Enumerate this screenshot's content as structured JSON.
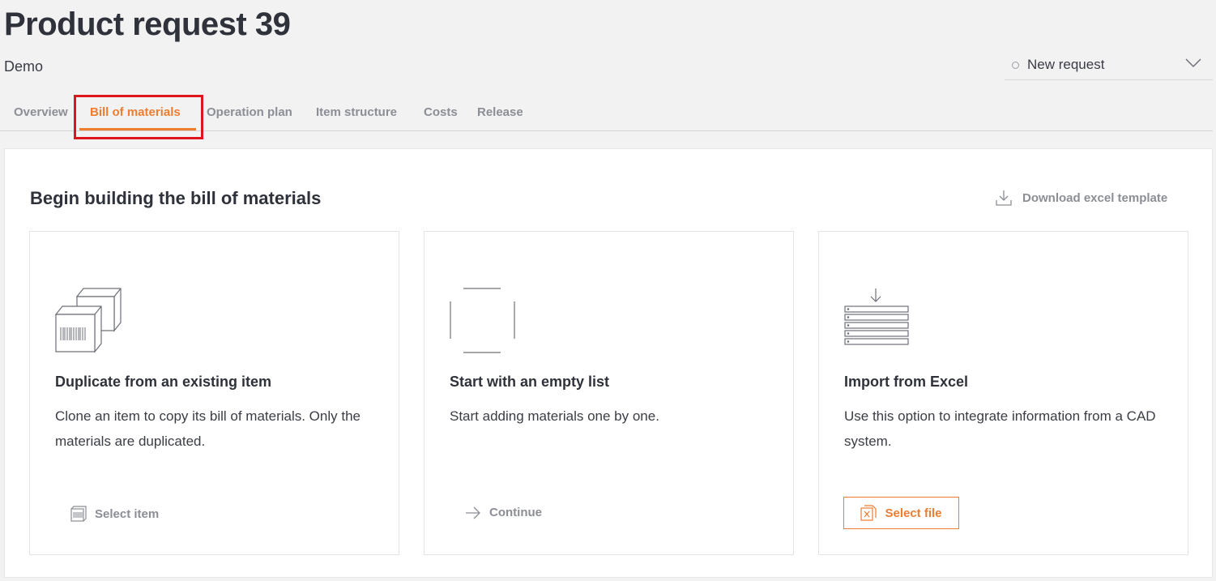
{
  "header": {
    "title": "Product request 39",
    "subtitle": "Demo",
    "status": "New request"
  },
  "tabs": [
    {
      "label": "Overview"
    },
    {
      "label": "Bill of materials",
      "active": true
    },
    {
      "label": "Operation plan"
    },
    {
      "label": "Item structure"
    },
    {
      "label": "Costs"
    },
    {
      "label": "Release"
    }
  ],
  "panel": {
    "title": "Begin building the bill of materials",
    "download_label": "Download excel template"
  },
  "cards": [
    {
      "title": "Duplicate from an existing item",
      "description": "Clone an item to copy its bill of materials. Only the materials are duplicated.",
      "action_label": "Select item",
      "icon": "barcode-box-icon"
    },
    {
      "title": "Start with an empty list",
      "description": "Start adding materials one by one.",
      "action_label": "Continue",
      "icon": "arrow-right-icon"
    },
    {
      "title": "Import from Excel",
      "description": "Use this option to integrate information from a CAD system.",
      "action_label": "Select file",
      "icon": "excel-file-icon"
    }
  ],
  "colors": {
    "accent": "#ee7d30",
    "highlight": "#e0141c",
    "muted_text": "#8b8e95",
    "background": "#f2f2f3"
  }
}
